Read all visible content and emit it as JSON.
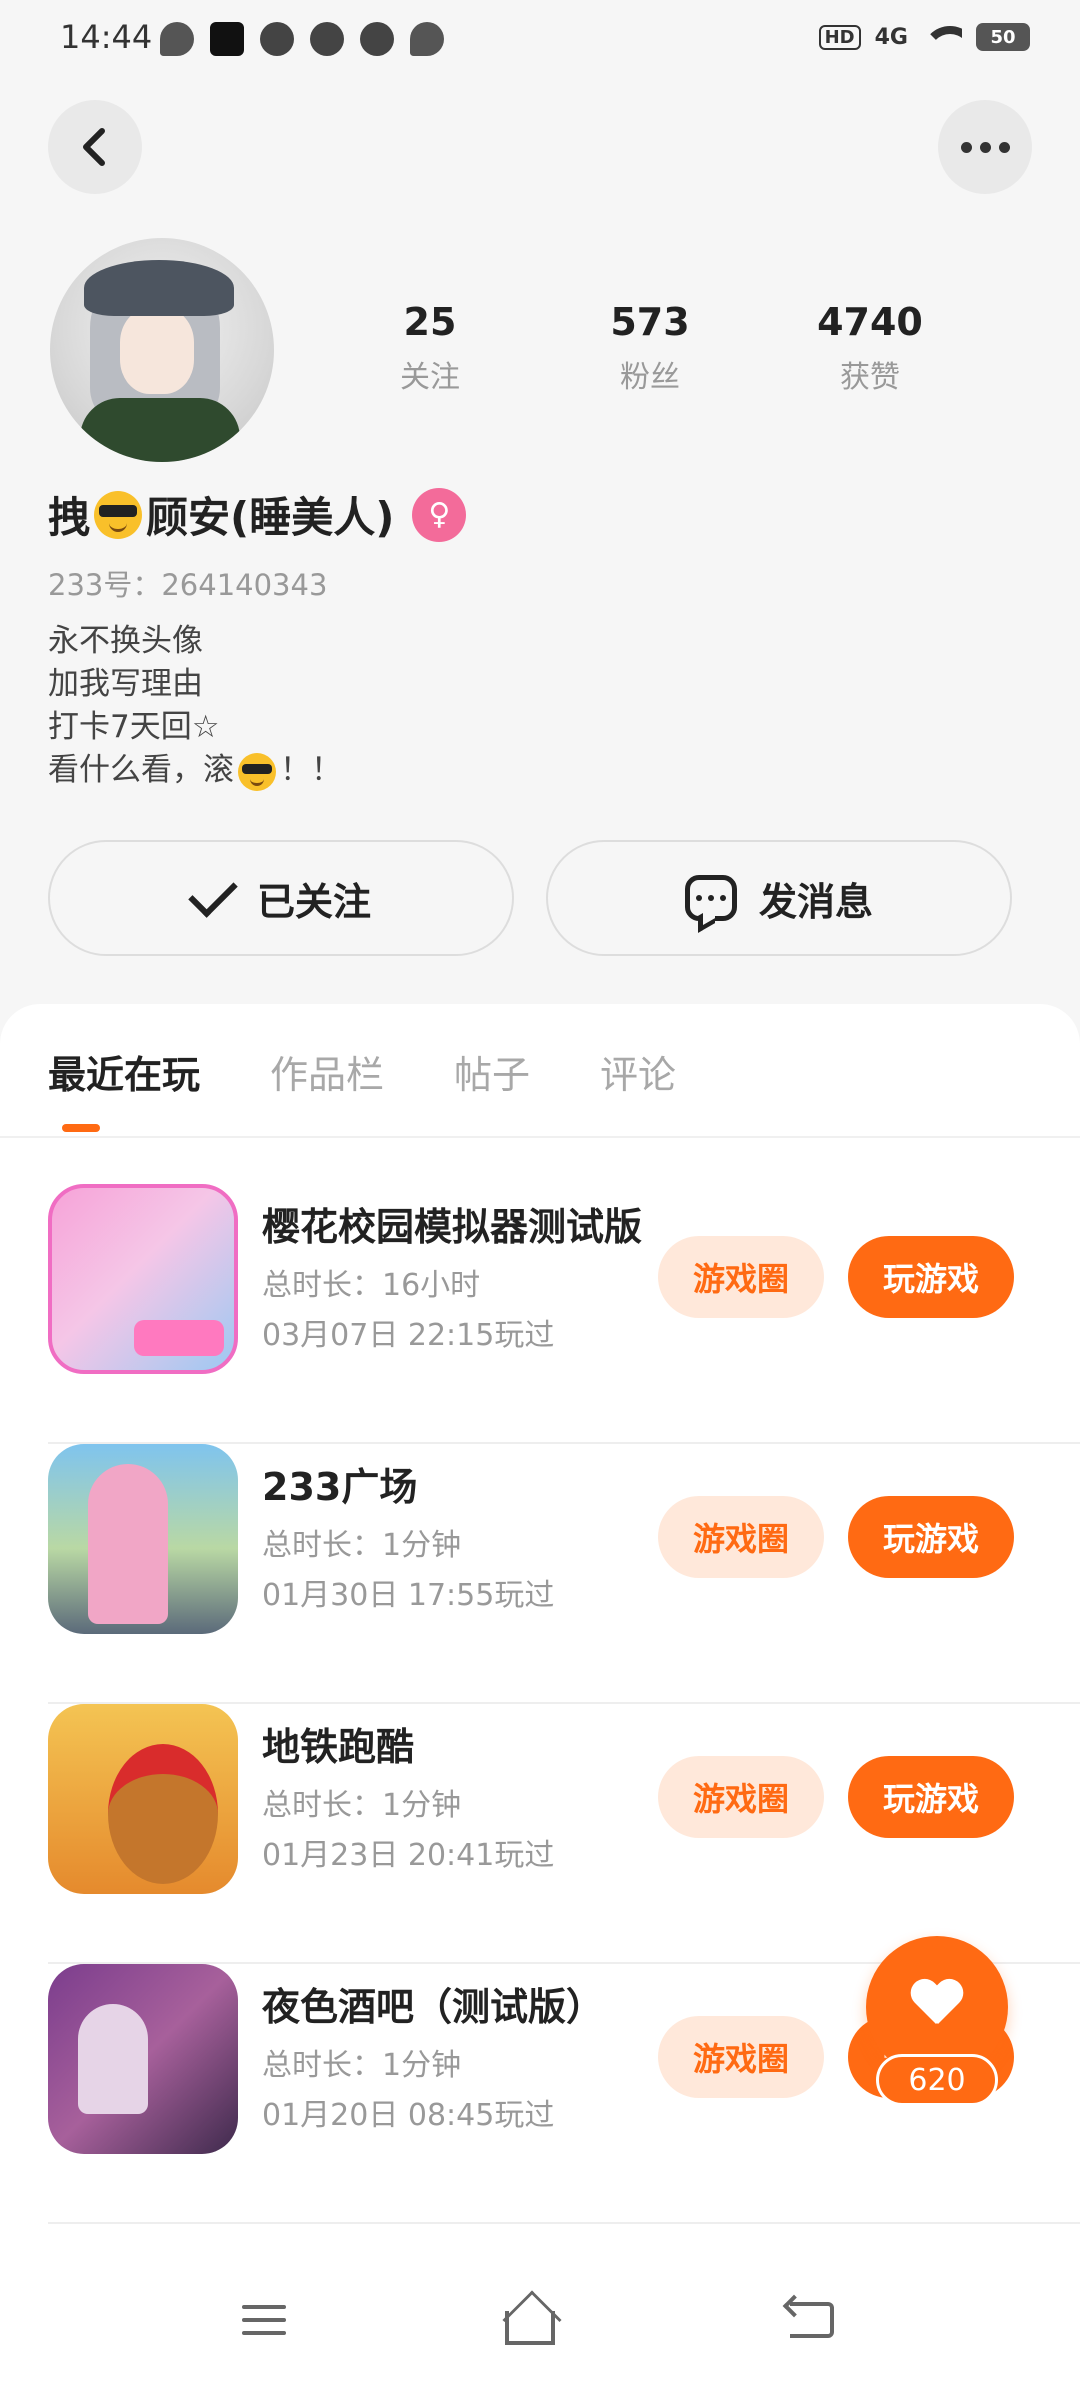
{
  "status_bar": {
    "time": "14:44",
    "hd": "HD",
    "network": "4G",
    "battery": "50"
  },
  "profile": {
    "stats": [
      {
        "value": "25",
        "label": "关注"
      },
      {
        "value": "573",
        "label": "粉丝"
      },
      {
        "value": "4740",
        "label": "获赞"
      }
    ],
    "name_part1": "拽",
    "name_part2": "顾安(睡美人)",
    "gender_symbol": "♀",
    "uid": "233号：264140343",
    "bio_lines": [
      "永不换头像",
      "加我写理由",
      "打卡7天回☆"
    ],
    "bio_last_prefix": "看什么看，滚",
    "bio_last_suffix": "！！"
  },
  "actions": {
    "follow_label": "已关注",
    "message_label": "发消息"
  },
  "tabs": [
    "最近在玩",
    "作品栏",
    "帖子",
    "评论"
  ],
  "games": [
    {
      "title": "樱花校园模拟器测试版",
      "duration": "总时长：16小时",
      "last_played": "03月07日  22:15玩过"
    },
    {
      "title": "233广场",
      "duration": "总时长：1分钟",
      "last_played": "01月30日  17:55玩过"
    },
    {
      "title": "地铁跑酷",
      "duration": "总时长：1分钟",
      "last_played": "01月23日  20:41玩过"
    },
    {
      "title": "夜色酒吧（测试版）",
      "duration": "总时长：1分钟",
      "last_played": "01月20日  08:45玩过"
    }
  ],
  "game_buttons": {
    "circle_label": "游戏圈",
    "play_label": "玩游戏"
  },
  "like": {
    "count": "620"
  },
  "colors": {
    "accent": "#ff6a13",
    "accent_light": "#ffe8da",
    "gender_badge": "#f36b9a"
  }
}
